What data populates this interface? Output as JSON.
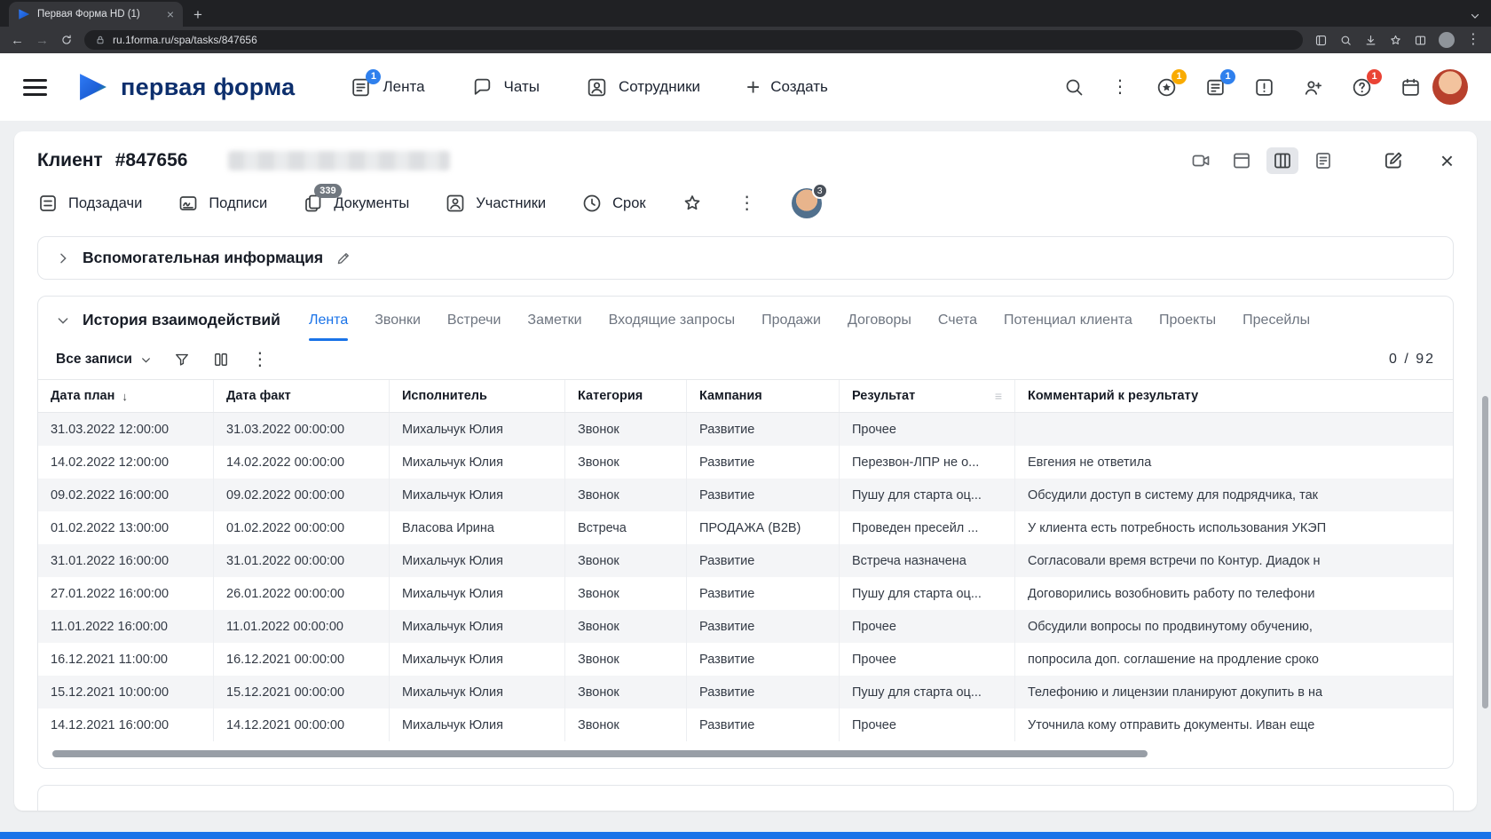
{
  "colors": {
    "accent_blue": "#1a73e8",
    "badge_yellow": "#f9ab00",
    "badge_blue": "#2f80ed",
    "badge_red": "#ea4335",
    "logo_navy": "#0d2f6d",
    "bottom_bar_blue": "#1a73e8",
    "row_stripe": "#f4f5f7"
  },
  "icons": {
    "kebab": "⋮",
    "plus": "+",
    "close": "×",
    "tab_close": "×",
    "new_tab": "+",
    "back": "←",
    "forward": "→",
    "sort_desc": "↓",
    "column_menu": "≡"
  },
  "browser": {
    "tab_title": "Первая Форма HD (1)",
    "url": "ru.1forma.ru/spa/tasks/847656"
  },
  "header": {
    "logo_text": "первая форма",
    "nav": [
      {
        "label": "Лента",
        "badge": "1"
      },
      {
        "label": "Чаты"
      },
      {
        "label": "Сотрудники"
      },
      {
        "label": "Создать"
      }
    ],
    "notifications": {
      "favorites_badge": "1",
      "inbox_badge": "1",
      "help_badge": "1"
    }
  },
  "task": {
    "type_label": "Клиент",
    "number": "#847656"
  },
  "toolbar": {
    "items": [
      {
        "label": "Подзадачи"
      },
      {
        "label": "Подписи"
      },
      {
        "label": "Документы",
        "badge": "339"
      },
      {
        "label": "Участники"
      },
      {
        "label": "Срок"
      }
    ],
    "participants_badge": "3"
  },
  "aux_section": {
    "title": "Вспомогательная информация"
  },
  "history": {
    "title": "История взаимодействий",
    "active_tab": "Лента",
    "tabs": [
      "Лента",
      "Звонки",
      "Встречи",
      "Заметки",
      "Входящие запросы",
      "Продажи",
      "Договоры",
      "Счета",
      "Потенциал клиента",
      "Проекты",
      "Пресейлы"
    ],
    "filter_label": "Все записи",
    "counter": "0 / 92",
    "table": {
      "columns": [
        "Дата план",
        "Дата факт",
        "Исполнитель",
        "Категория",
        "Кампания",
        "Результат",
        "Комментарий к результату"
      ],
      "rows": [
        [
          "31.03.2022 12:00:00",
          "31.03.2022 00:00:00",
          "Михальчук Юлия",
          "Звонок",
          "Развитие",
          "Прочее",
          ""
        ],
        [
          "14.02.2022 12:00:00",
          "14.02.2022 00:00:00",
          "Михальчук Юлия",
          "Звонок",
          "Развитие",
          "Перезвон-ЛПР не о...",
          "Евгения не ответила"
        ],
        [
          "09.02.2022 16:00:00",
          "09.02.2022 00:00:00",
          "Михальчук Юлия",
          "Звонок",
          "Развитие",
          "Пушу для старта оц...",
          "Обсудили доступ в систему для подрядчика, так"
        ],
        [
          "01.02.2022 13:00:00",
          "01.02.2022 00:00:00",
          "Власова Ирина",
          "Встреча",
          "ПРОДАЖА (B2B)",
          "Проведен пресейл ...",
          "У клиента есть потребность использования УКЭП"
        ],
        [
          "31.01.2022 16:00:00",
          "31.01.2022 00:00:00",
          "Михальчук Юлия",
          "Звонок",
          "Развитие",
          "Встреча назначена",
          "Согласовали время встречи по Контур. Диадок н"
        ],
        [
          "27.01.2022 16:00:00",
          "26.01.2022 00:00:00",
          "Михальчук Юлия",
          "Звонок",
          "Развитие",
          "Пушу для старта оц...",
          "Договорились возобновить работу по телефони"
        ],
        [
          "11.01.2022 16:00:00",
          "11.01.2022 00:00:00",
          "Михальчук Юлия",
          "Звонок",
          "Развитие",
          "Прочее",
          "Обсудили вопросы по продвинутому обучению,"
        ],
        [
          "16.12.2021 11:00:00",
          "16.12.2021 00:00:00",
          "Михальчук Юлия",
          "Звонок",
          "Развитие",
          "Прочее",
          "попросила доп. соглашение на продление сроко"
        ],
        [
          "15.12.2021 10:00:00",
          "15.12.2021 00:00:00",
          "Михальчук Юлия",
          "Звонок",
          "Развитие",
          "Пушу для старта оц...",
          "Телефонию и лицензии планируют докупить в на"
        ],
        [
          "14.12.2021 16:00:00",
          "14.12.2021 00:00:00",
          "Михальчук Юлия",
          "Звонок",
          "Развитие",
          "Прочее",
          "Уточнила кому отправить документы. Иван еще"
        ]
      ]
    }
  }
}
